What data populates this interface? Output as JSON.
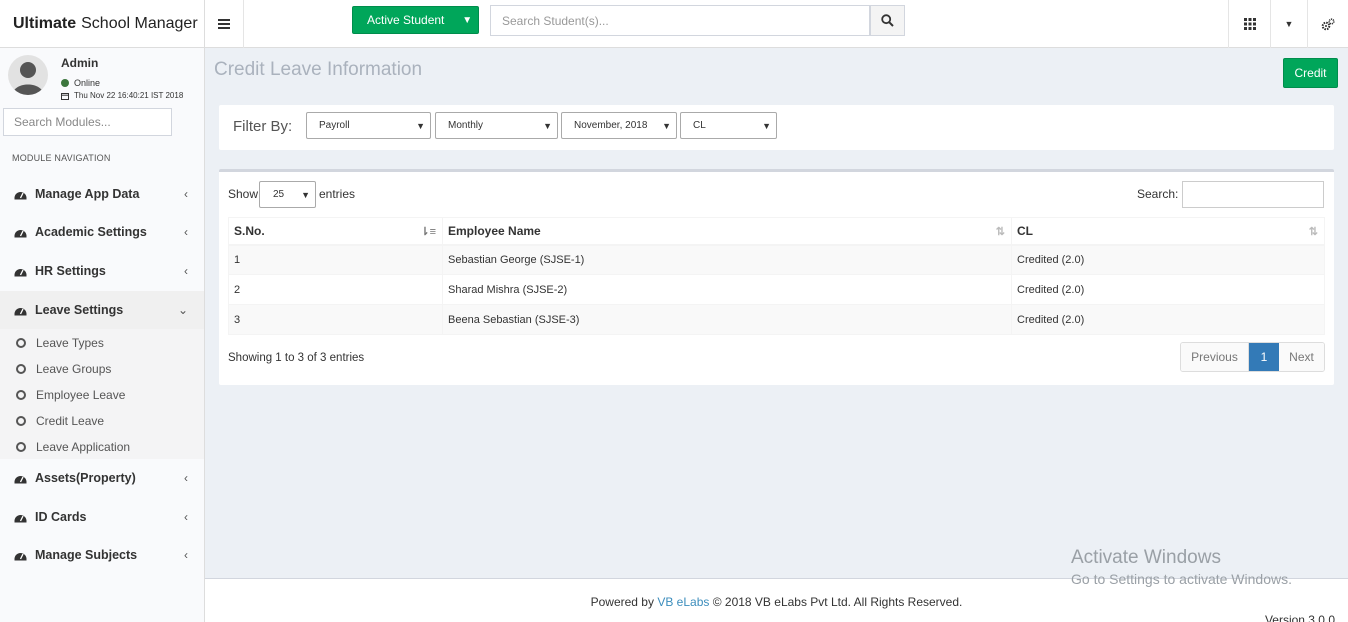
{
  "app": {
    "title_bold": "Ultimate",
    "title_rest": "School Manager"
  },
  "topbar": {
    "active_student_label": "Active Student",
    "search_placeholder": "Search Student(s)..."
  },
  "user": {
    "name": "Admin",
    "status": "Online",
    "datetime": "Thu Nov 22 16:40:21 IST 2018"
  },
  "sidebar": {
    "search_placeholder": "Search Modules...",
    "nav_header": "MODULE NAVIGATION",
    "items": [
      {
        "label": "Manage App Data"
      },
      {
        "label": "Academic Settings"
      },
      {
        "label": "HR Settings"
      },
      {
        "label": "Leave Settings"
      },
      {
        "label": "Assets(Property)"
      },
      {
        "label": "ID Cards"
      },
      {
        "label": "Manage Subjects"
      }
    ],
    "leave_sub": [
      {
        "label": "Leave Types"
      },
      {
        "label": "Leave Groups"
      },
      {
        "label": "Employee Leave"
      },
      {
        "label": "Credit Leave"
      },
      {
        "label": "Leave Application"
      }
    ]
  },
  "main": {
    "page_title": "Credit Leave Information",
    "credit_button": "Credit",
    "filter": {
      "label": "Filter By:",
      "category": "Payroll",
      "period": "Monthly",
      "month": "November, 2018",
      "leave_type": "CL"
    },
    "table": {
      "show_label": "Show",
      "page_length": "25",
      "entries_label": "entries",
      "search_label": "Search:",
      "columns": [
        "S.No.",
        "Employee Name",
        "CL"
      ],
      "rows": [
        {
          "sno": "1",
          "name": "Sebastian George (SJSE-1)",
          "cl": "Credited (2.0)"
        },
        {
          "sno": "2",
          "name": "Sharad Mishra (SJSE-2)",
          "cl": "Credited (2.0)"
        },
        {
          "sno": "3",
          "name": "Beena Sebastian (SJSE-3)",
          "cl": "Credited (2.0)"
        }
      ],
      "info": "Showing 1 to 3 of 3 entries",
      "pagination": {
        "previous": "Previous",
        "current": "1",
        "next": "Next"
      }
    }
  },
  "footer": {
    "powered_by": "Powered by",
    "company_link": "VB eLabs",
    "copyright": "© 2018 VB eLabs Pvt Ltd. All Rights Reserved.",
    "version": "Version 3.0.0"
  },
  "watermark": {
    "line1": "Activate Windows",
    "line2": "Go to Settings to activate Windows."
  },
  "colors": {
    "accent_green": "#00a65a",
    "pager_active": "#337ab7",
    "link": "#3c8dbc"
  }
}
